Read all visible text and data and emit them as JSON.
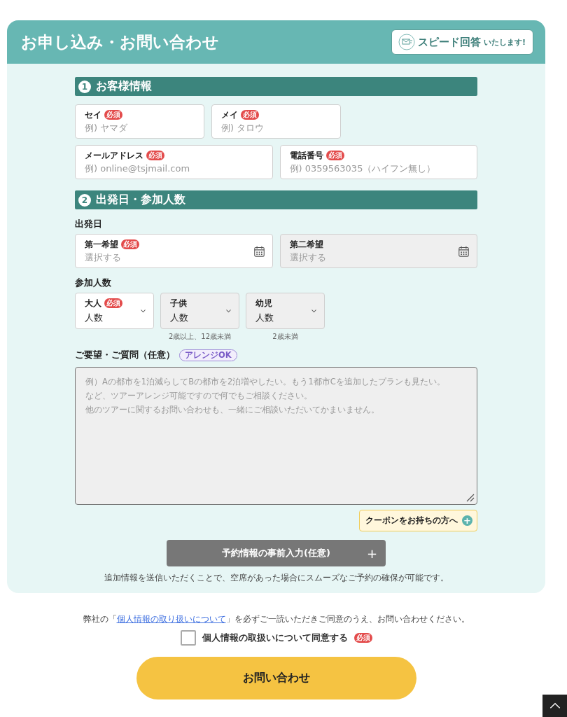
{
  "form": {
    "title": "お申し込み・お問い合わせ",
    "badge": {
      "main": "スピード回答",
      "sub": "いたします!"
    }
  },
  "sections": [
    {
      "number": "1",
      "title": "お客様情報",
      "rows": [
        {
          "kind": "text",
          "fields": [
            {
              "label": "セイ",
              "badge": "必須",
              "disabled": false,
              "placeholder": "例) ヤマダ"
            },
            {
              "label": "メイ",
              "badge": "必須",
              "disabled": false,
              "placeholder": "例) タロウ"
            }
          ]
        },
        {
          "kind": "text",
          "fields": [
            {
              "label": "メールアドレス",
              "badge": "必須",
              "disabled": false,
              "placeholder": "例) online@tsjmail.com"
            },
            {
              "label": "電話番号",
              "badge": "必須",
              "disabled": false,
              "placeholder": "例) 0359563035（ハイフン無し）"
            }
          ]
        }
      ]
    },
    {
      "number": "2",
      "title": "出発日・参加人数",
      "rows": [
        {
          "kind": "date",
          "heading": "出発日",
          "fields": [
            {
              "label": "第一希望",
              "badge": "必須",
              "disabled": false,
              "placeholder": "選択する"
            },
            {
              "label": "第二希望",
              "disabled": true,
              "placeholder": "選択する"
            }
          ]
        },
        {
          "kind": "select",
          "heading": "参加人数",
          "fields": [
            {
              "label": "大人",
              "badge": "必須",
              "disabled": false,
              "value": "人数"
            },
            {
              "label": "子供",
              "disabled": true,
              "value": "人数",
              "note": "2歳以上、12歳未満"
            },
            {
              "label": "幼児",
              "disabled": true,
              "value": "人数",
              "note": "2歳未満"
            }
          ]
        }
      ]
    }
  ],
  "request": {
    "heading": "ご要望・ご質問（任意）",
    "tag": "アレンジOK",
    "placeholder_lines": [
      "例）Aの都市を1泊減らしてBの都市を2泊増やしたい。もう1都市Cを追加したプランも見たい。",
      "など、ツアーアレンジ可能ですので何でもご相談ください。",
      "他のツアーに関するお問い合わせも、一緒にご相談いただいてかまいません。"
    ]
  },
  "coupon": {
    "label": "クーポンをお持ちの方へ",
    "icon": "+"
  },
  "prefill": {
    "label": "予約情報の事前入力(任意)",
    "icon": "+",
    "note": "追加情報を送信いただくことで、空席があった場合にスムーズなご予約の確保が可能です。"
  },
  "privacy": {
    "before": "弊社の「",
    "link": "個人情報の取り扱いについて",
    "after": "」を必ずご一読いただきご同意のうえ、お問い合わせください。"
  },
  "consent": {
    "label": "個人情報の取扱いについて同意する",
    "checked": false,
    "badge": "必須"
  },
  "submit": {
    "label": "お問い合わせ"
  }
}
